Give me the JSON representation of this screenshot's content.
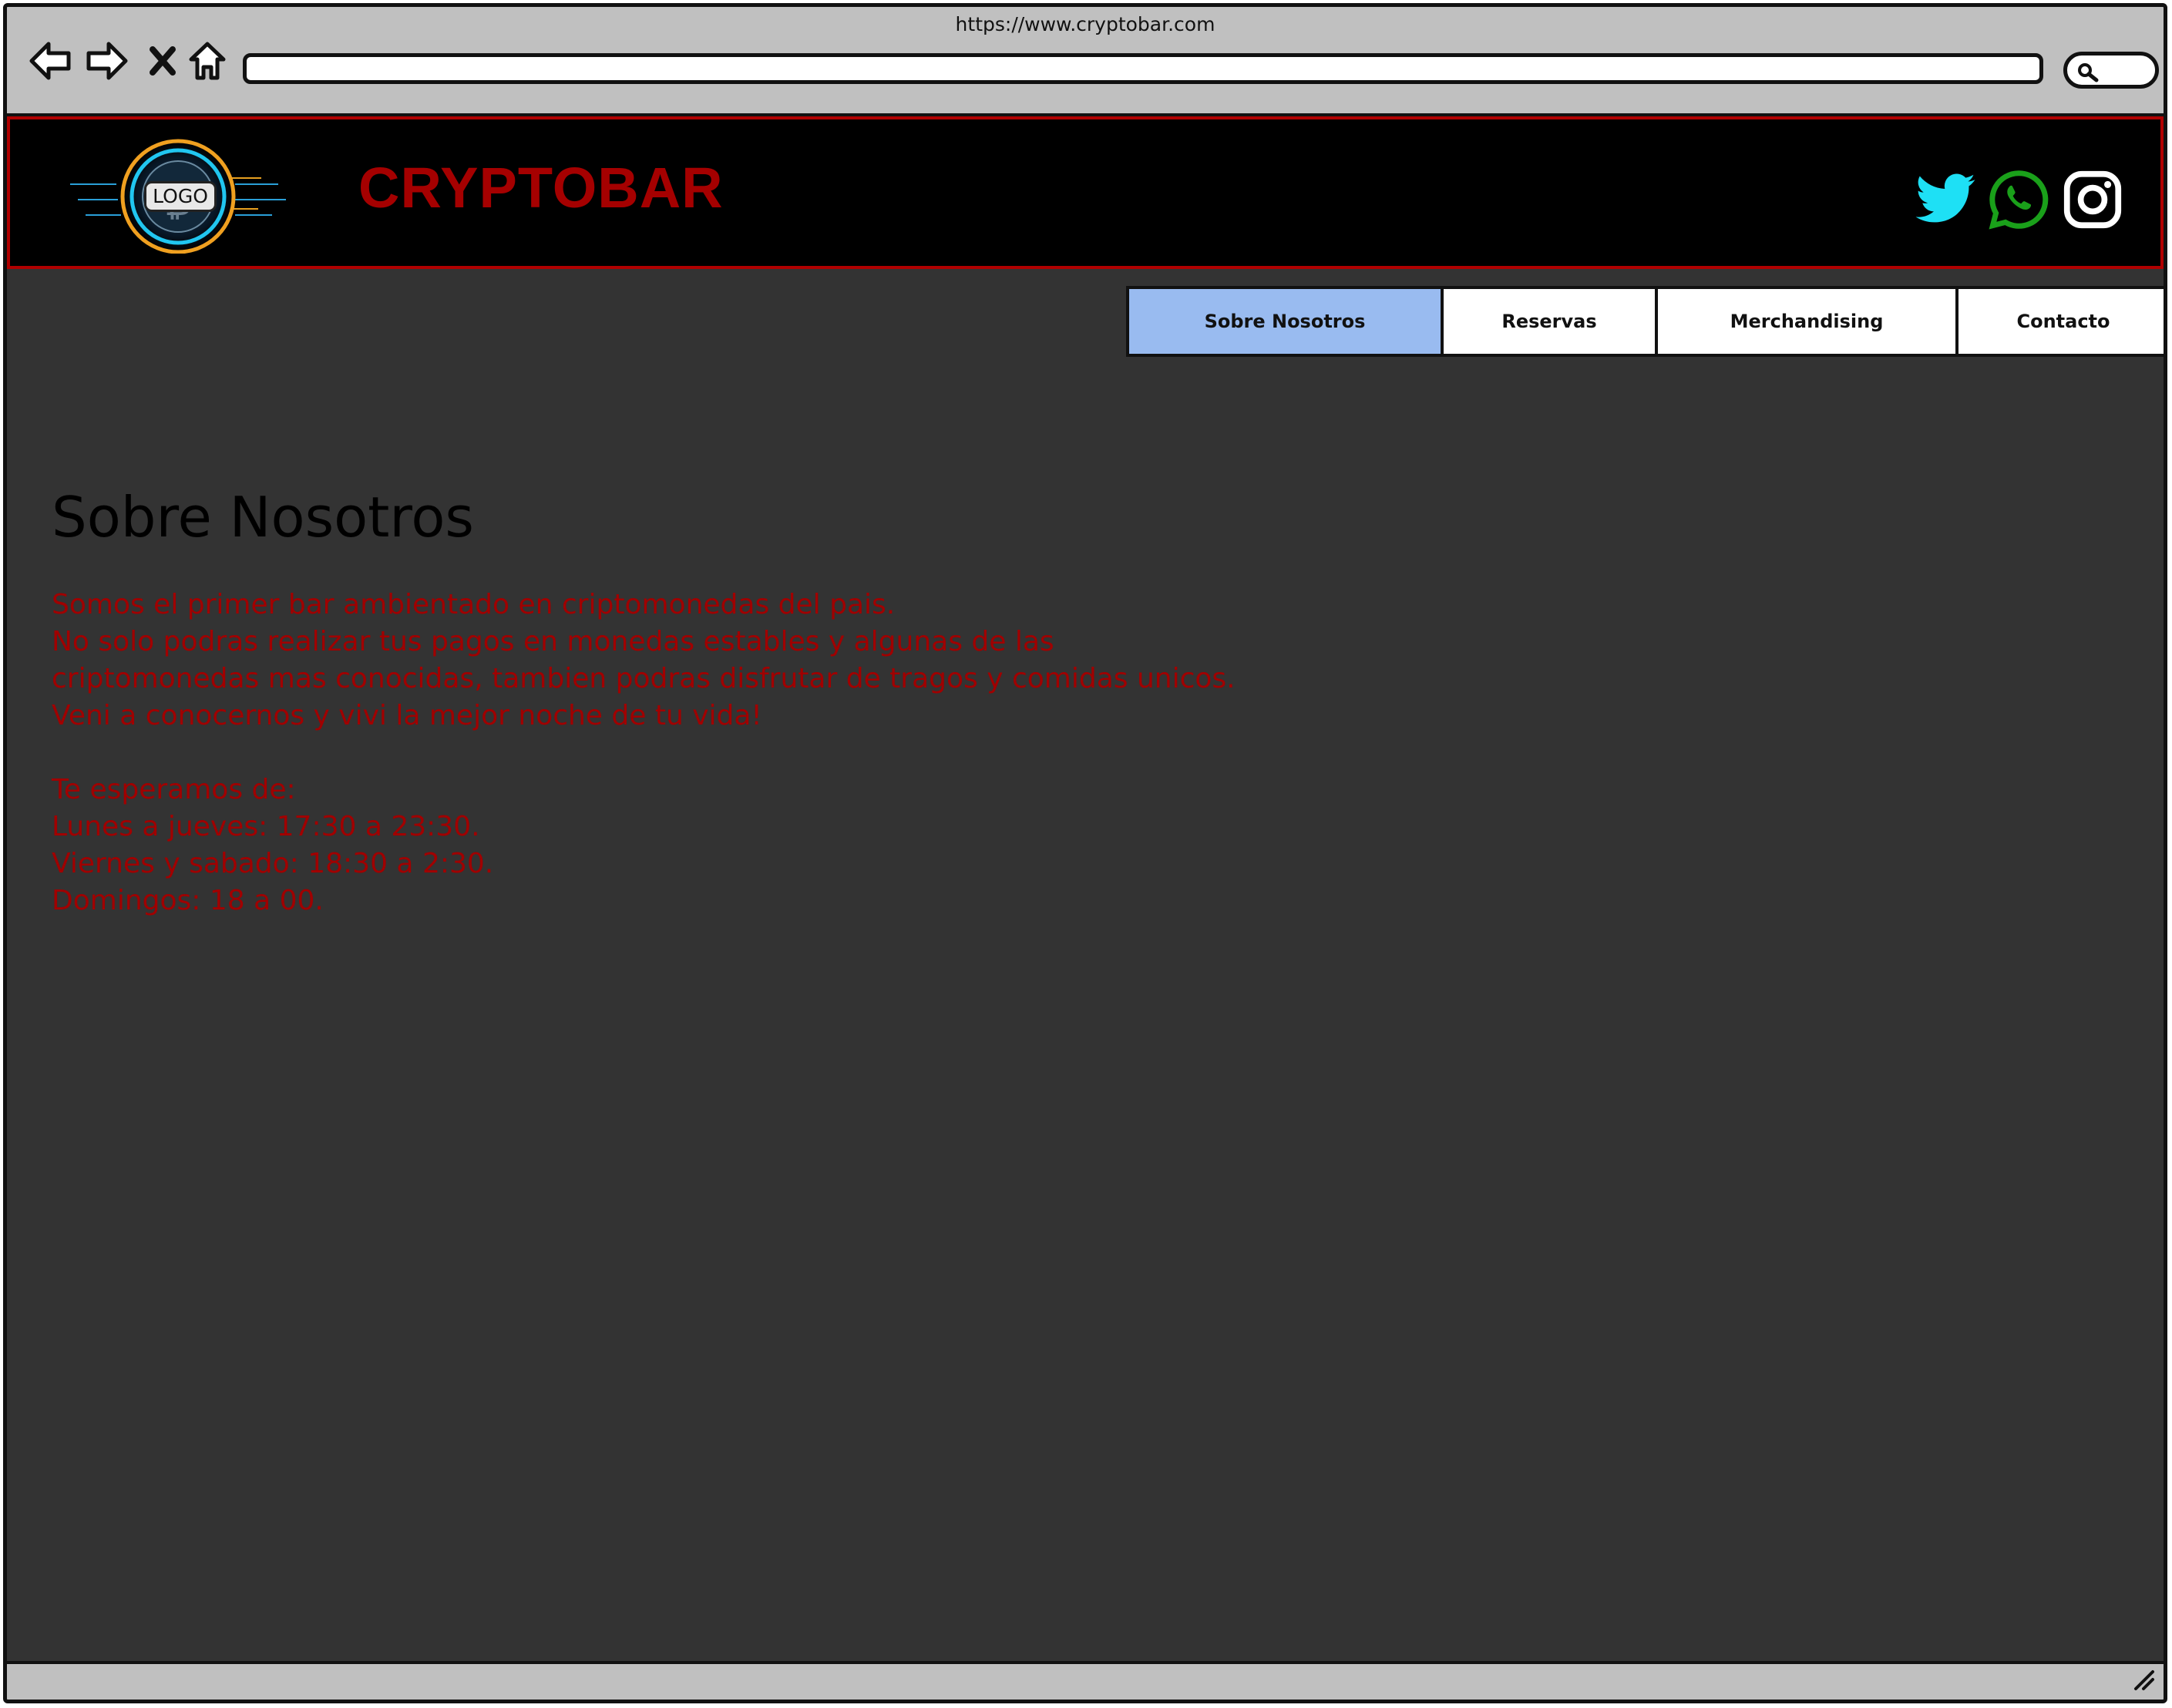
{
  "browser": {
    "url": "https://www.cryptobar.com",
    "icons": [
      "back-arrow-icon",
      "forward-arrow-icon",
      "stop-icon",
      "home-icon",
      "search-icon"
    ]
  },
  "header": {
    "logo_text": "LOGO",
    "brand": "CRYPTOBAR",
    "brand_color": "#a50000",
    "social_icons": [
      "twitter-icon",
      "whatsapp-icon",
      "instagram-icon"
    ]
  },
  "nav": {
    "tabs": [
      {
        "label": "Sobre Nosotros",
        "active": true
      },
      {
        "label": "Reservas",
        "active": false
      },
      {
        "label": "Merchandising",
        "active": false
      },
      {
        "label": "Contacto",
        "active": false
      }
    ],
    "active_color": "#99bbf0"
  },
  "main": {
    "title": "Sobre Nosotros",
    "paragraph": [
      "Somos el primer bar ambientado en criptomonedas del pais.",
      "No solo podras realizar tus pagos en monedas estables y algunas de las",
      "criptomonedas mas conocidas, tambien podras disfrutar de tragos y comidas unicos.",
      "Veni a conocernos y vivi la mejor noche de tu vida!"
    ],
    "hours_title": "Te esperamos de:",
    "hours": [
      "Lunes a jueves: 17:30 a 23:30.",
      "Viernes y sabado: 18:30 a 2:30.",
      "Domingos: 18 a 00."
    ],
    "text_color": "#a00000",
    "background": "#333333"
  }
}
